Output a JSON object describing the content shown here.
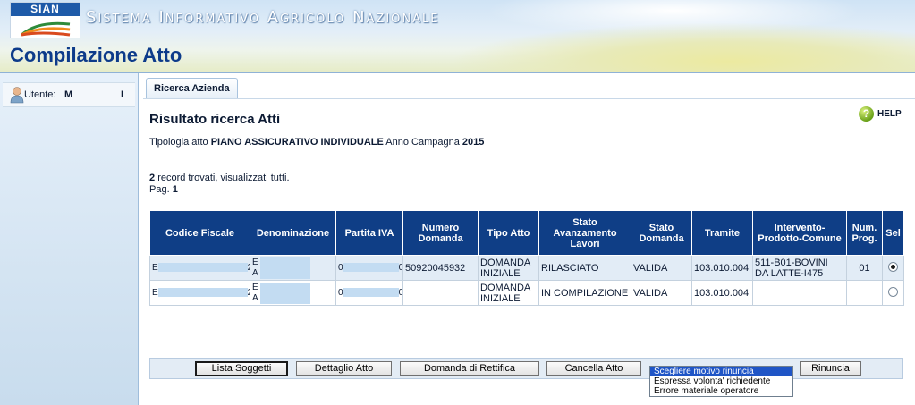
{
  "header": {
    "logo_text": "SIAN",
    "system_title": "Sistema Informativo Agricolo Nazionale",
    "page_title": "Compilazione Atto"
  },
  "sidebar": {
    "user_label": "Utente:",
    "user_name_initial": "M",
    "user_name_end": "I"
  },
  "tabs": [
    {
      "label": "Ricerca Azienda"
    }
  ],
  "main": {
    "title": "Risultato ricerca Atti",
    "help_label": "HELP",
    "tipologia_prefix": "Tipologia atto",
    "tipologia_value": "PIANO ASSICURATIVO INDIVIDUALE",
    "anno_prefix": "Anno Campagna",
    "anno_value": "2015",
    "records_count": "2",
    "records_text": "record trovati, visualizzati tutti.",
    "page_prefix": "Pag.",
    "page_value": "1"
  },
  "table": {
    "columns": [
      "Codice Fiscale",
      "Denominazione",
      "Partita IVA",
      "Numero Domanda",
      "Tipo Atto",
      "Stato Avanzamento Lavori",
      "Stato Domanda",
      "Tramite",
      "Intervento-Prodotto-Comune",
      "Num. Prog.",
      "Sel"
    ],
    "rows": [
      {
        "cf_start": "E",
        "cf_end": "2",
        "den_line1": "E",
        "den_line2": "A",
        "piva_start": "0",
        "piva_end": "0",
        "numero_domanda": "50920045932",
        "tipo_atto": "DOMANDA INIZIALE",
        "stato_lavori": "RILASCIATO",
        "stato_domanda": "VALIDA",
        "tramite": "103.010.004",
        "intervento": "511-B01-BOVINI DA LATTE-I475",
        "num_prog": "01",
        "selected": true
      },
      {
        "cf_start": "E",
        "cf_end": "2",
        "den_line1": "E",
        "den_line2": "A",
        "piva_start": "0",
        "piva_end": "0",
        "numero_domanda": "",
        "tipo_atto": "DOMANDA INIZIALE",
        "stato_lavori": "IN COMPILAZIONE",
        "stato_domanda": "VALIDA",
        "tramite": "103.010.004",
        "intervento": "",
        "num_prog": "",
        "selected": false
      }
    ]
  },
  "toolbar": {
    "lista_soggetti": "Lista Soggetti",
    "dettaglio_atto": "Dettaglio Atto",
    "domanda_rettifica": "Domanda di Rettifica",
    "cancella_atto": "Cancella Atto",
    "rinuncia": "Rinuncia",
    "rinuncia_options": [
      "Scegliere motivo rinuncia",
      "Espressa volonta' richiedente",
      "Errore materiale operatore"
    ],
    "rinuncia_selected": "Scegliere motivo rinuncia"
  },
  "colors": {
    "header_blue": "#0f3e86",
    "title_blue": "#0d3b8a",
    "row_alt": "#e2ecf6",
    "select_highlight": "#1f55c6"
  }
}
